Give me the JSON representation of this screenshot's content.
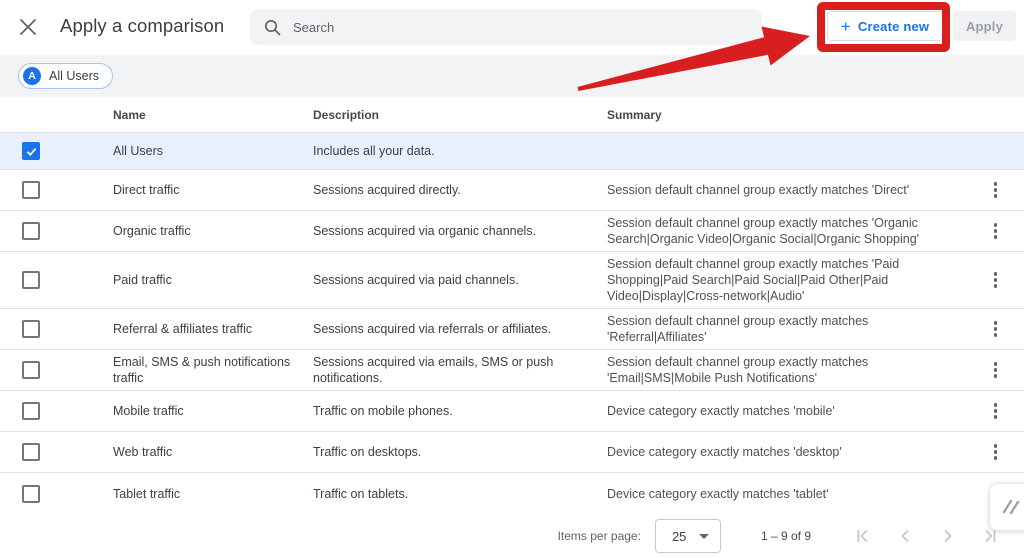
{
  "header": {
    "title": "Apply a comparison",
    "search": {
      "placeholder": "Search"
    },
    "create_new": {
      "plus": "+",
      "label": "Create new"
    },
    "apply_label": "Apply"
  },
  "chip": {
    "avatar": "A",
    "label": "All Users"
  },
  "table": {
    "columns": [
      "Name",
      "Description",
      "Summary"
    ],
    "rows": [
      {
        "name": "All Users",
        "description": "Includes all your data.",
        "summary": "",
        "checked": true,
        "selected": true,
        "menu": false
      },
      {
        "name": "Direct traffic",
        "description": "Sessions acquired directly.",
        "summary": "Session default channel group exactly matches 'Direct'",
        "checked": false,
        "selected": false,
        "menu": true
      },
      {
        "name": "Organic traffic",
        "description": "Sessions acquired via organic channels.",
        "summary": "Session default channel group exactly matches 'Organic Search|Organic Video|Organic Social|Organic Shopping'",
        "checked": false,
        "selected": false,
        "menu": true
      },
      {
        "name": "Paid traffic",
        "description": "Sessions acquired via paid channels.",
        "summary": "Session default channel group exactly matches 'Paid Shopping|Paid Search|Paid Social|Paid Other|Paid Video|Display|Cross-network|Audio'",
        "checked": false,
        "selected": false,
        "menu": true
      },
      {
        "name": "Referral & affiliates traffic",
        "description": "Sessions acquired via referrals or affiliates.",
        "summary": "Session default channel group exactly matches 'Referral|Affiliates'",
        "checked": false,
        "selected": false,
        "menu": true
      },
      {
        "name": "Email, SMS & push notifications traffic",
        "description": "Sessions acquired via emails, SMS or push notifications.",
        "summary": "Session default channel group exactly matches 'Email|SMS|Mobile Push Notifications'",
        "checked": false,
        "selected": false,
        "menu": true
      },
      {
        "name": "Mobile traffic",
        "description": "Traffic on mobile phones.",
        "summary": "Device category exactly matches 'mobile'",
        "checked": false,
        "selected": false,
        "menu": true
      },
      {
        "name": "Web traffic",
        "description": "Traffic on desktops.",
        "summary": "Device category exactly matches 'desktop'",
        "checked": false,
        "selected": false,
        "menu": true
      },
      {
        "name": "Tablet traffic",
        "description": "Traffic on tablets.",
        "summary": "Device category exactly matches 'tablet'",
        "checked": false,
        "selected": false,
        "menu": true
      }
    ]
  },
  "footer": {
    "items_per_page_label": "Items per page:",
    "items_per_page_value": "25",
    "range_label": "1 – 9 of 9",
    "pagination_icons": [
      "first-page-icon",
      "previous-page-icon",
      "next-page-icon",
      "last-page-icon"
    ]
  },
  "icons": {
    "close": "close-icon",
    "search": "search-icon",
    "plus": "plus-icon",
    "kebab": "more-vertical-icon",
    "checkmark": "checkmark-icon",
    "dropdown_caret": "caret-down-icon",
    "floating": "screen-capture-widget-icon"
  },
  "colors": {
    "accent_blue": "#1a73e8",
    "annotation_red": "#d81f1f",
    "selected_row_bg": "#e8f0fe",
    "band_gray": "#f1f3f4",
    "disabled_gray": "#9aa0a6"
  }
}
